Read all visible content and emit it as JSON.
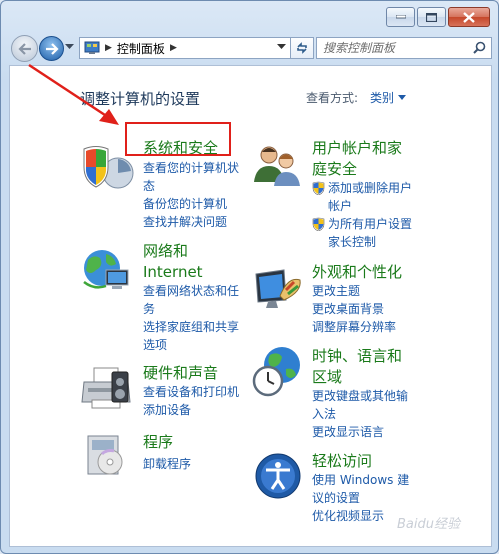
{
  "window": {
    "colors": {
      "accent": "#1e5aa8",
      "category_green": "#1a7a1a",
      "highlight_red": "#e0201a"
    }
  },
  "nav": {
    "address_item": "控制面板",
    "search_placeholder": "搜索控制面板"
  },
  "header": {
    "title": "调整计算机的设置",
    "view_by_label": "查看方式:",
    "view_by_value": "类别"
  },
  "categories": [
    {
      "title": "系统和安全",
      "icon": "shield-icon",
      "links": [
        "查看您的计算机状",
        "态",
        "备份您的计算机",
        "查找并解决问题"
      ]
    },
    {
      "title": "网络和",
      "title2": "Internet",
      "icon": "network-icon",
      "links": [
        "查看网络状态和任",
        "务",
        "选择家庭组和共享",
        "选项"
      ]
    },
    {
      "title": "硬件和声音",
      "icon": "printer-icon",
      "links": [
        "查看设备和打印机",
        "添加设备"
      ]
    },
    {
      "title": "程序",
      "icon": "programs-icon",
      "links": [
        "卸载程序"
      ]
    },
    {
      "title": "用户帐户和家",
      "title2": "庭安全",
      "icon": "users-icon",
      "links": [
        "添加或删除用户",
        "帐户",
        "为所有用户设置",
        "家长控制"
      ]
    },
    {
      "title": "外观和个性化",
      "icon": "appearance-icon",
      "links": [
        "更改主题",
        "更改桌面背景",
        "调整屏幕分辨率"
      ]
    },
    {
      "title": "时钟、语言和",
      "title2": "区域",
      "icon": "clock-globe-icon",
      "links": [
        "更改键盘或其他输",
        "入法",
        "更改显示语言"
      ]
    },
    {
      "title": "轻松访问",
      "icon": "ease-of-access-icon",
      "links": [
        "使用 Windows 建",
        "议的设置",
        "优化视频显示"
      ]
    }
  ],
  "watermark": "Baidu经验"
}
